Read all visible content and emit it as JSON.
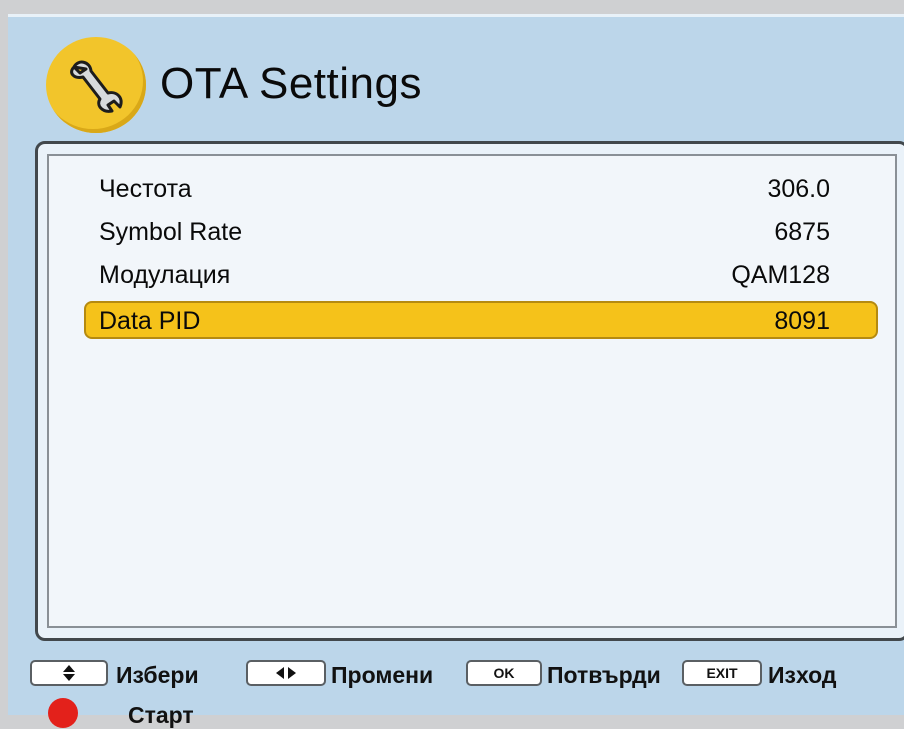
{
  "header": {
    "title": "OTA Settings",
    "icon": "wrench-icon",
    "accent_color": "#f2c52b"
  },
  "settings": [
    {
      "label": "Честота",
      "value": "306.0"
    },
    {
      "label": "Symbol  Rate",
      "value": "6875"
    },
    {
      "label": "Модулация",
      "value": "QAM128"
    },
    {
      "label": "Data  PID",
      "value": "8091",
      "selected": true
    }
  ],
  "footer": {
    "keys": [
      {
        "icon": "up-down-arrows-icon",
        "glyph": "◆",
        "label": "Избери"
      },
      {
        "icon": "left-right-arrows-icon",
        "glyph": "◀▶",
        "label": "Промени"
      },
      {
        "key_text": "OK",
        "label": "Потвърди"
      },
      {
        "key_text": "EXIT",
        "label": "Изход"
      }
    ],
    "red_button": {
      "icon": "red-button-icon",
      "label": "Старт",
      "color": "#e3211b"
    }
  },
  "colors": {
    "background": "#bcd6ea",
    "highlight": "#f5c21a",
    "panel": "#f2f6fa"
  }
}
